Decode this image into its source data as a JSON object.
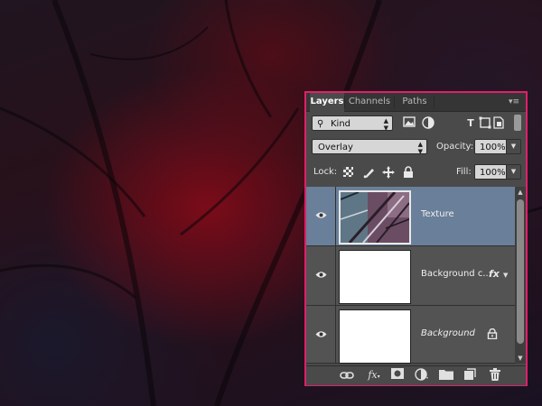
{
  "panel": {
    "tabs": [
      {
        "label": "Layers",
        "active": true
      },
      {
        "label": "Channels",
        "active": false
      },
      {
        "label": "Paths",
        "active": false
      }
    ],
    "filter": {
      "kind_label": "Kind",
      "filter_icons": [
        "image-filter-icon",
        "adjustment-filter-icon",
        "type-filter-icon",
        "shape-filter-icon",
        "smart-object-filter-icon"
      ]
    },
    "blend": {
      "mode": "Overlay",
      "opacity_label": "Opacity:",
      "opacity_value": "100%"
    },
    "lock": {
      "label": "Lock:",
      "fill_label": "Fill:",
      "fill_value": "100%"
    },
    "layers": [
      {
        "name": "Texture",
        "selected": true,
        "thumbnail": "texture-thumbnail",
        "fx": false,
        "locked": false,
        "italic": false
      },
      {
        "name": "Background c...",
        "selected": false,
        "thumbnail": "white-thumbnail",
        "fx": true,
        "fx_label": "fx",
        "locked": false,
        "italic": false
      },
      {
        "name": "Background",
        "selected": false,
        "thumbnail": "white-thumbnail",
        "fx": false,
        "locked": true,
        "italic": true
      }
    ],
    "bottom_icons": [
      "link-layers-icon",
      "fx-icon",
      "add-mask-icon",
      "adjustment-layer-icon",
      "new-group-icon",
      "new-layer-icon",
      "trash-icon"
    ],
    "bottom_fx_label": "fx",
    "colors": {
      "panel_border": "#e0206a",
      "panel_bg": "#4a4a4a",
      "selected_layer": "#6a7f99"
    }
  }
}
